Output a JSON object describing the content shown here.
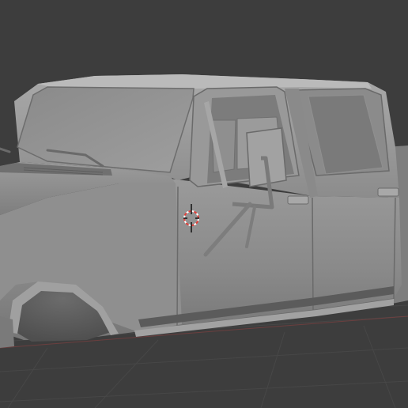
{
  "viewport": {
    "background_color": "#3d3d3d",
    "grid_line_color": "#474747",
    "grid_axis_color": "#8a3f3f",
    "mesh_base_color": "#8e8e8e",
    "mesh_light_color": "#b4b4b4",
    "mesh_shadow_color": "#5e5e5e",
    "cursor_colors": [
      "#e0403a",
      "#ffffff",
      "#101010"
    ]
  },
  "object": {
    "icon": "truck-body-mesh"
  },
  "cursor": {
    "icon": "3d-cursor-icon"
  }
}
